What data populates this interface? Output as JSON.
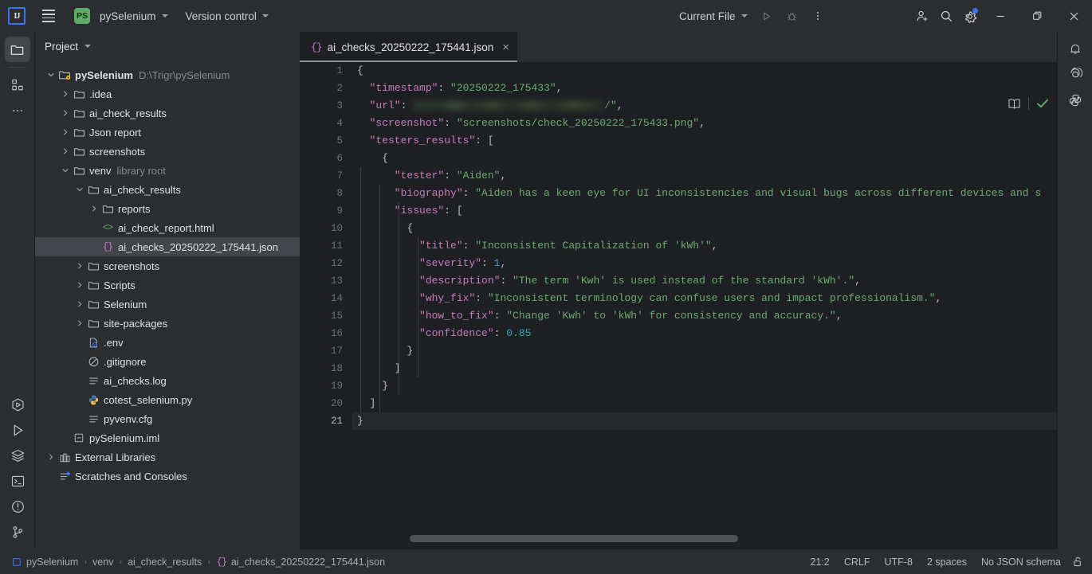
{
  "toolbar": {
    "ide_logo": "ij-logo",
    "menu_icon": "hamburger-menu-icon",
    "project_badge": "PS",
    "project_name": "pySelenium",
    "version_control": "Version control",
    "run_config": "Current File",
    "run_icon": "run-icon",
    "debug_icon": "debug-icon",
    "more_icon": "more-actions-icon",
    "account_icon": "account-icon",
    "search_icon": "search-icon",
    "settings_icon": "settings-gear-icon",
    "minimize": "minimize-icon",
    "maximize": "maximize-icon",
    "close": "close-icon"
  },
  "activity_bar": {
    "items": [
      {
        "name": "project-icon",
        "label": "Project",
        "active": true
      },
      {
        "name": "structure-icon",
        "label": "Structure",
        "active": false
      },
      {
        "name": "more-tool-windows-icon",
        "label": "More",
        "active": false
      }
    ],
    "bottom_items": [
      {
        "name": "run-with-coverage-icon",
        "label": "Coverage"
      },
      {
        "name": "run-icon",
        "label": "Run"
      },
      {
        "name": "services-icon",
        "label": "Services"
      },
      {
        "name": "terminal-icon",
        "label": "Terminal"
      },
      {
        "name": "problems-icon",
        "label": "Problems"
      },
      {
        "name": "version-control-icon",
        "label": "Version Control"
      }
    ]
  },
  "right_bar": {
    "items": [
      {
        "name": "notifications-bell-icon",
        "label": "Notifications"
      },
      {
        "name": "ai-assistant-icon",
        "label": "AI Assistant"
      },
      {
        "name": "python-packages-icon",
        "label": "Python Packages"
      }
    ]
  },
  "project_panel": {
    "title": "Project",
    "tree": [
      {
        "indent": 0,
        "arrow": "down",
        "icon": "project-root-icon",
        "label": "pySelenium",
        "bold": true,
        "sub": "D:\\Trigr\\pySelenium",
        "selected": false
      },
      {
        "indent": 1,
        "arrow": "right",
        "icon": "folder-icon",
        "label": ".idea",
        "bold": false,
        "sub": "",
        "selected": false
      },
      {
        "indent": 1,
        "arrow": "right",
        "icon": "folder-icon",
        "label": "ai_check_results",
        "bold": false,
        "sub": "",
        "selected": false
      },
      {
        "indent": 1,
        "arrow": "right",
        "icon": "folder-icon",
        "label": "Json report",
        "bold": false,
        "sub": "",
        "selected": false
      },
      {
        "indent": 1,
        "arrow": "right",
        "icon": "folder-icon",
        "label": "screenshots",
        "bold": false,
        "sub": "",
        "selected": false
      },
      {
        "indent": 1,
        "arrow": "down",
        "icon": "folder-icon",
        "label": "venv",
        "bold": false,
        "sub": "library root",
        "selected": false
      },
      {
        "indent": 2,
        "arrow": "down",
        "icon": "folder-icon",
        "label": "ai_check_results",
        "bold": false,
        "sub": "",
        "selected": false
      },
      {
        "indent": 3,
        "arrow": "right",
        "icon": "folder-icon",
        "label": "reports",
        "bold": false,
        "sub": "",
        "selected": false
      },
      {
        "indent": 3,
        "arrow": "none",
        "icon": "html-file-icon",
        "label": "ai_check_report.html",
        "bold": false,
        "sub": "",
        "selected": false
      },
      {
        "indent": 3,
        "arrow": "none",
        "icon": "json-file-icon",
        "label": "ai_checks_20250222_175441.json",
        "bold": false,
        "sub": "",
        "selected": true
      },
      {
        "indent": 2,
        "arrow": "right",
        "icon": "folder-icon",
        "label": "screenshots",
        "bold": false,
        "sub": "",
        "selected": false
      },
      {
        "indent": 2,
        "arrow": "right",
        "icon": "folder-icon",
        "label": "Scripts",
        "bold": false,
        "sub": "",
        "selected": false
      },
      {
        "indent": 2,
        "arrow": "right",
        "icon": "folder-icon",
        "label": "Selenium",
        "bold": false,
        "sub": "",
        "selected": false
      },
      {
        "indent": 2,
        "arrow": "right",
        "icon": "folder-icon",
        "label": "site-packages",
        "bold": false,
        "sub": "",
        "selected": false
      },
      {
        "indent": 2,
        "arrow": "none",
        "icon": "env-file-icon",
        "label": ".env",
        "bold": false,
        "sub": "",
        "selected": false
      },
      {
        "indent": 2,
        "arrow": "none",
        "icon": "gitignore-file-icon",
        "label": ".gitignore",
        "bold": false,
        "sub": "",
        "selected": false
      },
      {
        "indent": 2,
        "arrow": "none",
        "icon": "log-file-icon",
        "label": "ai_checks.log",
        "bold": false,
        "sub": "",
        "selected": false
      },
      {
        "indent": 2,
        "arrow": "none",
        "icon": "python-file-icon",
        "label": "cotest_selenium.py",
        "bold": false,
        "sub": "",
        "selected": false
      },
      {
        "indent": 2,
        "arrow": "none",
        "icon": "cfg-file-icon",
        "label": "pyvenv.cfg",
        "bold": false,
        "sub": "",
        "selected": false
      },
      {
        "indent": 1,
        "arrow": "none",
        "icon": "iml-file-icon",
        "label": "pySelenium.iml",
        "bold": false,
        "sub": "",
        "selected": false
      },
      {
        "indent": 0,
        "arrow": "right",
        "icon": "external-libraries-icon",
        "label": "External Libraries",
        "bold": false,
        "sub": "",
        "selected": false
      },
      {
        "indent": 0,
        "arrow": "none",
        "icon": "scratches-icon",
        "label": "Scratches and Consoles",
        "bold": false,
        "sub": "",
        "selected": false
      }
    ]
  },
  "editor": {
    "tab": {
      "icon": "json-file-icon",
      "label": "ai_checks_20250222_175441.json",
      "close": "×"
    },
    "reading_mode_icon": "reading-mode-book-icon",
    "inspections_icon": "inspections-ok-checkmark-icon",
    "lightbulb_icon": "intention-bulb-icon",
    "lines": [
      {
        "num": 1,
        "segments": [
          {
            "t": "p",
            "v": "{"
          }
        ]
      },
      {
        "num": 2,
        "segments": [
          {
            "t": "k",
            "v": "  \"timestamp\""
          },
          {
            "t": "p",
            "v": ": "
          },
          {
            "t": "s",
            "v": "\"20250222_175433\""
          },
          {
            "t": "p",
            "v": ","
          }
        ]
      },
      {
        "num": 3,
        "segments": [
          {
            "t": "k",
            "v": "  \"url\""
          },
          {
            "t": "p",
            "v": ": "
          },
          {
            "t": "blur",
            "v": ""
          },
          {
            "t": "s",
            "v": "/\""
          },
          {
            "t": "p",
            "v": ","
          }
        ]
      },
      {
        "num": 4,
        "segments": [
          {
            "t": "k",
            "v": "  \"screenshot\""
          },
          {
            "t": "p",
            "v": ": "
          },
          {
            "t": "s",
            "v": "\"screenshots/check_20250222_175433.png\""
          },
          {
            "t": "p",
            "v": ","
          }
        ]
      },
      {
        "num": 5,
        "segments": [
          {
            "t": "k",
            "v": "  \"testers_results\""
          },
          {
            "t": "p",
            "v": ": ["
          }
        ]
      },
      {
        "num": 6,
        "segments": [
          {
            "t": "p",
            "v": "    {"
          }
        ]
      },
      {
        "num": 7,
        "segments": [
          {
            "t": "k",
            "v": "      \"tester\""
          },
          {
            "t": "p",
            "v": ": "
          },
          {
            "t": "s",
            "v": "\"Aiden\""
          },
          {
            "t": "p",
            "v": ","
          }
        ]
      },
      {
        "num": 8,
        "segments": [
          {
            "t": "k",
            "v": "      \"biography\""
          },
          {
            "t": "p",
            "v": ": "
          },
          {
            "t": "s",
            "v": "\"Aiden has a keen eye for UI inconsistencies and visual bugs across different devices and s"
          }
        ]
      },
      {
        "num": 9,
        "segments": [
          {
            "t": "k",
            "v": "      \"issues\""
          },
          {
            "t": "p",
            "v": ": ["
          }
        ]
      },
      {
        "num": 10,
        "segments": [
          {
            "t": "p",
            "v": "        {"
          }
        ]
      },
      {
        "num": 11,
        "segments": [
          {
            "t": "k",
            "v": "          \"title\""
          },
          {
            "t": "p",
            "v": ": "
          },
          {
            "t": "s",
            "v": "\"Inconsistent Capitalization of 'kWh'\""
          },
          {
            "t": "p",
            "v": ","
          }
        ]
      },
      {
        "num": 12,
        "segments": [
          {
            "t": "k",
            "v": "          \"severity\""
          },
          {
            "t": "p",
            "v": ": "
          },
          {
            "t": "n",
            "v": "1"
          },
          {
            "t": "p",
            "v": ","
          }
        ]
      },
      {
        "num": 13,
        "segments": [
          {
            "t": "k",
            "v": "          \"description\""
          },
          {
            "t": "p",
            "v": ": "
          },
          {
            "t": "s",
            "v": "\"The term 'Kwh' is used instead of the standard 'kWh'.\""
          },
          {
            "t": "p",
            "v": ","
          }
        ]
      },
      {
        "num": 14,
        "segments": [
          {
            "t": "k",
            "v": "          \"why_fix\""
          },
          {
            "t": "p",
            "v": ": "
          },
          {
            "t": "s",
            "v": "\"Inconsistent terminology can confuse users and impact professionalism.\""
          },
          {
            "t": "p",
            "v": ","
          }
        ]
      },
      {
        "num": 15,
        "segments": [
          {
            "t": "k",
            "v": "          \"how_to_fix\""
          },
          {
            "t": "p",
            "v": ": "
          },
          {
            "t": "s",
            "v": "\"Change 'Kwh' to 'kWh' for consistency and accuracy.\""
          },
          {
            "t": "p",
            "v": ","
          }
        ]
      },
      {
        "num": 16,
        "segments": [
          {
            "t": "k",
            "v": "          \"confidence\""
          },
          {
            "t": "p",
            "v": ": "
          },
          {
            "t": "n",
            "v": "0.85"
          }
        ]
      },
      {
        "num": 17,
        "segments": [
          {
            "t": "p",
            "v": "        }"
          }
        ]
      },
      {
        "num": 18,
        "segments": [
          {
            "t": "p",
            "v": "      ]"
          }
        ]
      },
      {
        "num": 19,
        "segments": [
          {
            "t": "p",
            "v": "    }"
          }
        ]
      },
      {
        "num": 20,
        "segments": [
          {
            "t": "p",
            "v": "  ]"
          }
        ]
      },
      {
        "num": 21,
        "segments": [
          {
            "t": "p",
            "v": "}"
          }
        ]
      }
    ],
    "current_line": 21
  },
  "status_bar": {
    "breadcrumb": [
      {
        "icon": "module-icon",
        "label": "pySelenium"
      },
      {
        "icon": "",
        "label": "venv"
      },
      {
        "icon": "",
        "label": "ai_check_results"
      },
      {
        "icon": "json-file-icon",
        "label": "ai_checks_20250222_175441.json"
      }
    ],
    "separator": "›",
    "caret_position": "21:2",
    "line_separator": "CRLF",
    "encoding": "UTF-8",
    "indent": "2 spaces",
    "schema": "No JSON schema",
    "lock_icon": "unlocked-padlock-icon"
  },
  "colors": {
    "accent_blue": "#3574f0",
    "string_green": "#6aab73",
    "key_purple": "#c77dbb",
    "number_cyan": "#2aacb8",
    "panel_bg": "#2b2d30",
    "editor_bg": "#1e1f22",
    "selection": "#43454a"
  }
}
